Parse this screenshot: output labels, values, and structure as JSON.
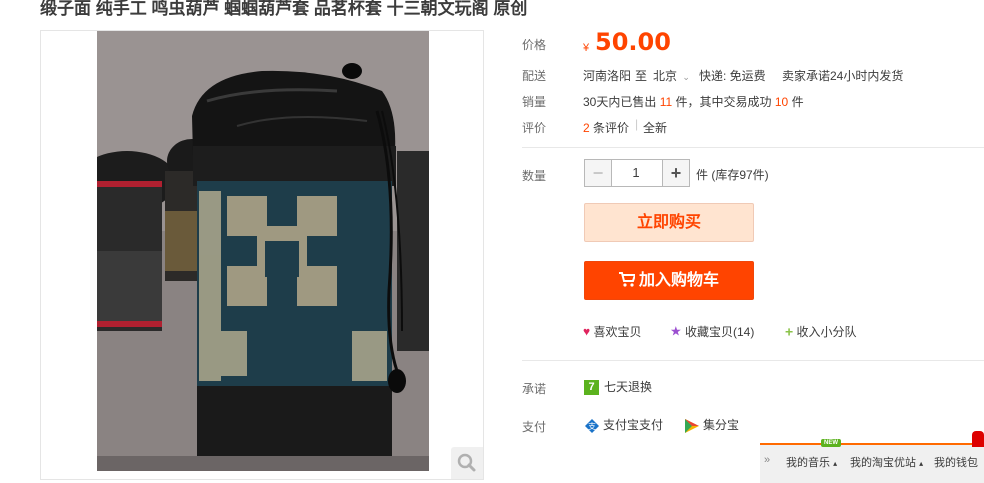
{
  "product": {
    "title": "缎子面 纯手工 鸣虫葫芦 蝈蝈葫芦套 品茗杯套 十三朝文玩阁 原创"
  },
  "price": {
    "label": "价格",
    "currency": "¥",
    "amount": "50.00"
  },
  "shipping": {
    "label": "配送",
    "from": "河南洛阳",
    "to_word": "至",
    "to": "北京",
    "method": "快递: 免运费",
    "promise": "卖家承诺24小时内发货"
  },
  "sales": {
    "label": "销量",
    "prefix": "30天内已售出",
    "sold": "11",
    "unit1": "件，其中交易成功",
    "success": "10",
    "unit2": "件"
  },
  "reviews": {
    "label": "评价",
    "count": "2",
    "count_suffix": "条评价",
    "condition": "全新"
  },
  "quantity": {
    "label": "数量",
    "value": "1",
    "stock_text": "件 (库存97件)"
  },
  "buttons": {
    "buy_now": "立即购买",
    "add_to_cart": "加入购物车"
  },
  "actions": {
    "like": "喜欢宝贝",
    "favorite": "收藏宝贝(14)",
    "add_team": "收入小分队"
  },
  "promise": {
    "label": "承诺",
    "badge": "7",
    "text": "七天退换"
  },
  "payment": {
    "label": "支付",
    "alipay": "支付宝支付",
    "jifenbao": "集分宝"
  },
  "bottom_bar": {
    "music": "我的音乐",
    "new_badge": "NEW",
    "taobao": "我的淘宝优站",
    "wallet": "我的钱包"
  },
  "colors": {
    "accent": "#ff4400",
    "buy_bg": "#ffe4d0",
    "green": "#5bb21e"
  }
}
